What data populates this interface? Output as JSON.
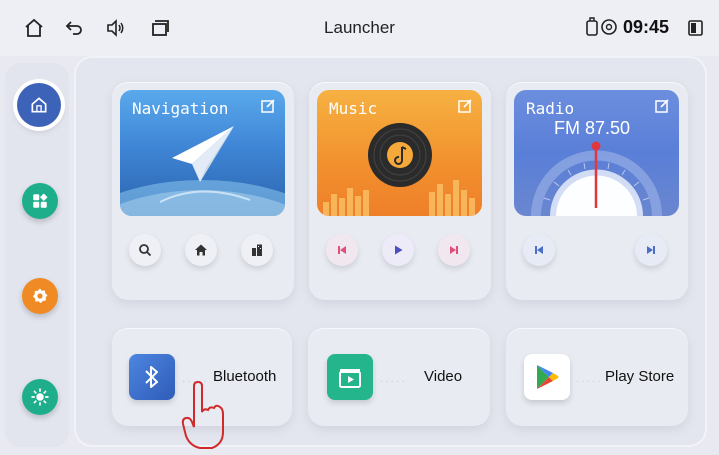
{
  "status_bar": {
    "title": "Launcher",
    "time": "09:45",
    "icons": [
      "home-icon",
      "back-icon",
      "volume-icon",
      "recent-apps-icon",
      "usb-icon",
      "location-icon",
      "battery-icon"
    ]
  },
  "sidebar": {
    "items": [
      {
        "icon": "home-icon",
        "color": "#3d63b8",
        "active": true
      },
      {
        "icon": "apps-icon",
        "color": "#1fae8c"
      },
      {
        "icon": "settings-icon",
        "color": "#f08a24"
      },
      {
        "icon": "brightness-icon",
        "color": "#1fae8c"
      }
    ]
  },
  "widgets": {
    "navigation": {
      "label": "Navigation",
      "controls": [
        "search-icon",
        "home-icon",
        "buildings-icon"
      ]
    },
    "music": {
      "label": "Music",
      "controls": [
        "previous-icon",
        "play-icon",
        "next-icon"
      ]
    },
    "radio": {
      "label": "Radio",
      "frequency": "FM 87.50",
      "controls": [
        "previous-icon",
        "next-icon"
      ]
    }
  },
  "apps": [
    {
      "label": "Bluetooth",
      "icon": "bluetooth-icon",
      "color": "#3b6fd0"
    },
    {
      "label": "Video",
      "icon": "video-icon",
      "color": "#25b58c"
    },
    {
      "label": "Play Store",
      "icon": "play-store-icon",
      "color": "#ffffff"
    }
  ],
  "colors": {
    "accent": "#3d63b8",
    "music": "#f2902d",
    "radio": "#5a7fd8",
    "navigation": "#3f86d6"
  }
}
